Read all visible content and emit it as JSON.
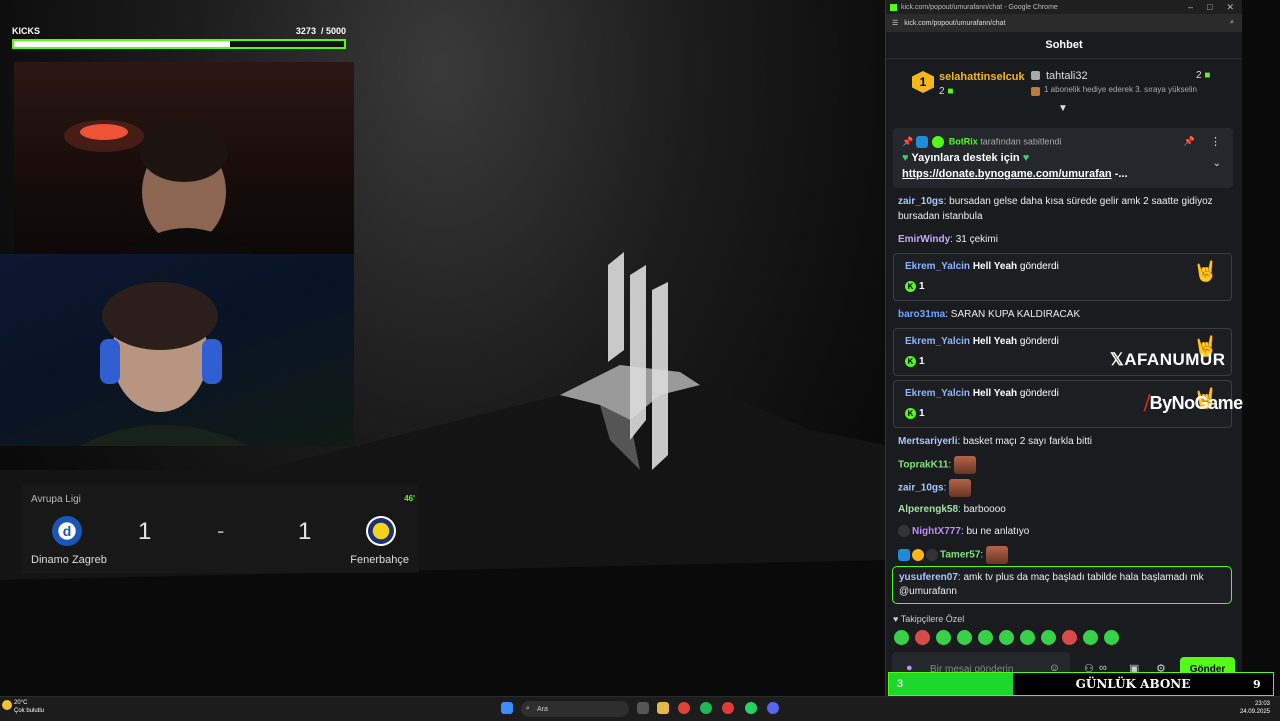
{
  "stream": {
    "kicks_label": "KICKS",
    "kicks_count": "3273",
    "kicks_goal": "/ 5000",
    "kicks_progress": 0.654
  },
  "scoreboard": {
    "league": "Avrupa Ligi",
    "minute": "46'",
    "home_team": "Dinamo Zagreb",
    "away_team": "Fenerbahçe",
    "home_score": "1",
    "away_score": "1",
    "separator": "-",
    "home_crest": "d"
  },
  "browser": {
    "title": "kick.com/popout/umurafann/chat - Google Chrome",
    "url": "kick.com/popout/umurafann/chat",
    "min": "–",
    "max": "□",
    "close": "✕"
  },
  "chat": {
    "header": "Sohbet",
    "leaderboard": {
      "first_rank": "1",
      "first_user": "selahattinselcuk",
      "first_count": "2",
      "second_user": "tahtali32",
      "second_count": "2",
      "second_note": "1 abonelik hediye ederek 3. sıraya yükselin"
    },
    "pinned": {
      "bot": "BotRix",
      "by": "tarafından sabitlendi",
      "text": "Yayınlara destek için",
      "link": "https://donate.bynogame.com/umurafan",
      "ellipsis": "-..."
    },
    "messages": [
      {
        "user": "zair_10gs",
        "text": ": bursadan gelse daha kısa sürede gelir amk 2 saatte gidiyoz bursadan istanbula",
        "color": "#a8c6ff"
      },
      {
        "user": "EmirWindy",
        "text": ": 31 çekimi",
        "color": "#c9a7ff"
      },
      {
        "user": "baro31ma",
        "text": ": SARAN KUPA KALDIRACAK",
        "color": "#6fa8ff"
      },
      {
        "user": "Mertsariyerli",
        "text": ": basket maçı 2 sayı farkla bitti",
        "color": "#a8c6ff"
      },
      {
        "user": "ToprakK11",
        "text": ":",
        "color": "#7fe27f"
      },
      {
        "user": "zair_10gs",
        "text": ":",
        "color": "#a8c6ff"
      },
      {
        "user": "Alperengk58",
        "text": ": barboooo",
        "color": "#9fe39f"
      },
      {
        "user": "NightX777",
        "text": ": bu ne anlatıyo",
        "color": "#c08bff"
      },
      {
        "user": "Tamer57",
        "text": ":",
        "color": "#7fe27f"
      }
    ],
    "gifts": [
      {
        "user": "Ekrem_Yalcin",
        "item": "Hell Yeah",
        "verb": "gönderdi",
        "amount": "1"
      },
      {
        "user": "Ekrem_Yalcin",
        "item": "Hell Yeah",
        "verb": "gönderdi",
        "amount": "1"
      },
      {
        "user": "Ekrem_Yalcin",
        "item": "Hell Yeah",
        "verb": "gönderdi",
        "amount": "1"
      }
    ],
    "reply": {
      "user": "yusuferen07",
      "text": ": amk tv plus da maç başladı tabilde hala başlamadı mk @umurafann"
    },
    "followers_label": "Takipçilere Özel",
    "input_placeholder": "Bir mesaj gönderin",
    "send_label": "Gönder",
    "emote_icons": [
      "pepe-icon",
      "pepe-icon",
      "pepe-icon",
      "pepe-icon",
      "pepe-icon",
      "pepe-icon",
      "pepe-icon",
      "pepe-icon",
      "pepe-icon",
      "pepe-icon"
    ]
  },
  "overlays": {
    "x_handle": "AFANUMUR",
    "sponsor": "ByNoGame",
    "sub_current": "3",
    "sub_title": "GÜNLÜK ABONE",
    "sub_goal": "9"
  },
  "taskbar": {
    "temp": "20°C",
    "weather": "Çok bulutlu",
    "search": "Ara",
    "time": "23:03",
    "date": "24.09.2025"
  },
  "colors": {
    "accent": "#53fc18",
    "chat_bg": "#191b1f"
  }
}
